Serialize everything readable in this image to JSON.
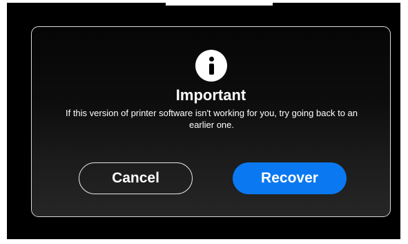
{
  "dialog": {
    "icon": "info-icon",
    "title": "Important",
    "message": "If this version of printer software isn't working for you, try going back to an earlier one.",
    "buttons": {
      "cancel_label": "Cancel",
      "recover_label": "Recover"
    }
  },
  "colors": {
    "background": "#000000",
    "dialog_border": "#d9d9d9",
    "primary_button": "#0a78f0",
    "text": "#ffffff"
  }
}
